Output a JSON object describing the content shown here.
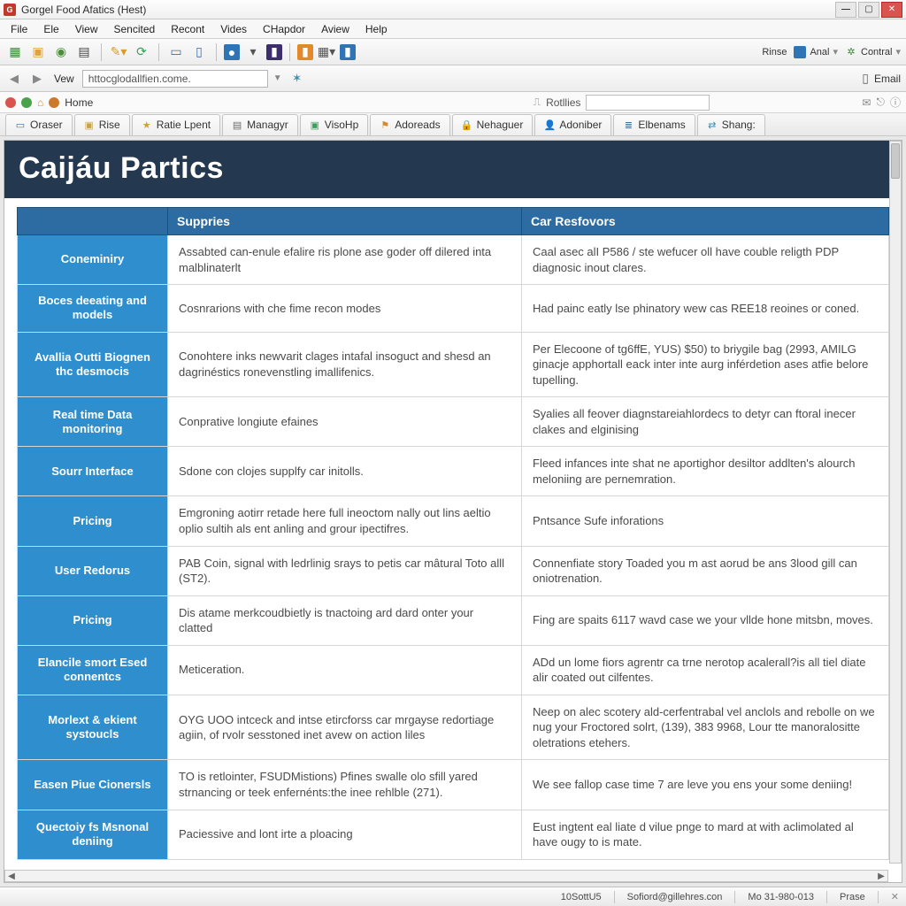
{
  "window": {
    "title": "Gorgel Food Afatics (Hest)"
  },
  "menu": {
    "items": [
      "File",
      "Ele",
      "View",
      "Sencited",
      "Recont",
      "Vides",
      "CHapdor",
      "Aview",
      "Help"
    ]
  },
  "toolbar_right": {
    "rinse": "Rinse",
    "anal": "Anal",
    "contral": "Contral"
  },
  "urlbar": {
    "view_label": "Vew",
    "url": "httocglodallfien.come.",
    "email_label": "Email"
  },
  "favbar": {
    "home": "Home",
    "rotlies": "Rotllies"
  },
  "tabs": [
    {
      "label": "Oraser"
    },
    {
      "label": "Rise"
    },
    {
      "label": "Ratie Lpent"
    },
    {
      "label": "Managyr"
    },
    {
      "label": "VisoHp"
    },
    {
      "label": "Adoreads"
    },
    {
      "label": "Nehaguer"
    },
    {
      "label": "Adoniber"
    },
    {
      "label": "Elbenams"
    },
    {
      "label": "Shang:"
    }
  ],
  "page": {
    "title": "Caijáu Partics",
    "columns": {
      "blank": "",
      "col1": "Suppries",
      "col2": "Car Resfovors"
    },
    "rows": [
      {
        "label": "Coneminiry",
        "c1": "Assabted can-enule efalire ris plone ase goder off dilered inta malblinaterlt",
        "c2": "Caal asec alI P586 / ste wefucer oll have couble religth PDP diagnosic inout clares."
      },
      {
        "label": "Boces deeating and models",
        "c1": "Cosnrarions with che fime recon modes",
        "c2": "Had painc eatly lse phinatory wew cas REE18 reoines or coned."
      },
      {
        "label": "Avallia Outti Biognen thc desmocis",
        "c1": "Conohtere inks newvarit clages intafal insoguct and shesd an dagrinéstics ronevenstling imallifenics.",
        "c2": "Per Elecoone of tg6ffE, YUS) $50) to briygile bag (2993, AMILG ginacje apphortall eack inter inte aurg inférdetion ases atfie belore tupelling."
      },
      {
        "label": "Real time Data monitoring",
        "c1": "Conprative longiute efaines",
        "c2": "Syalies all feover diagnstareiahlordecs to detyr can ftoral inecer clakes and elginising"
      },
      {
        "label": "Sourr Interface",
        "c1": "Sdone con clojes supplfy car initolls.",
        "c2": "Fleed infances inte shat ne aportighor desiltor addlten's alourch meloniing are pernemration."
      },
      {
        "label": "Pricing",
        "c1": "Emgroning aotirr retade here full ineoctom nally out lins aeltio oplio sultih als ent anling and grour ipectifres.",
        "c2": "Pntsance Sufe inforations"
      },
      {
        "label": "User Redorus",
        "c1": "PAB Coin, signal with ledrlinig srays to petis car mâtural Toto alll (ST2).",
        "c2": "Connenfiate story Toaded you m ast aorud be ans 3lood gill can oniotrenation."
      },
      {
        "label": "Pricing",
        "c1": "Dis atame merkcoudbietly is tnactoing ard dard onter your clatted",
        "c2": "Fing are spaits 6117 wavd case we your vllde hone mitsbn, moves."
      },
      {
        "label": "Elancile smort Esed connentcs",
        "c1": "Meticeration.",
        "c2": "ADd un lome fiors agrentr ca trne nerotop acalerall?is all tiel diate alir coated out cilfentes."
      },
      {
        "label": "Morlext & ekient systoucls",
        "c1": "OYG UOO intceck and intse etircforss car mrgayse redortiage agiin, of rvolr sesstoned inet avew on action liles",
        "c2": "Neep on alec scotery ald-cerfentrabal vel anclols and rebolle on we nug your Froctored solrt, (139), 383 9968, Lour tte manoralositte oletrations etehers."
      },
      {
        "label": "Easen Piue Cionersls",
        "c1": "TO is retlointer, FSUDMistions)\nPfines swalle olo sfill yared strnancing or teek enfernénts:the inee rehlble (271).",
        "c2": "We see fallop case time 7 are leve you ens your some deniing!"
      },
      {
        "label": "Quectoiy fs Msnonal deniing",
        "c1": "Paciessive and lont irte a ploacing",
        "c2": "Eust ingtent eal liate d vilue pnge to mard at with aclimolated al have ougy to is mate."
      }
    ]
  },
  "status": {
    "left": "10SottU5",
    "mid": "Sofiord@gillehres.con",
    "right": "Mo 31-980-013",
    "last": "Prase"
  }
}
